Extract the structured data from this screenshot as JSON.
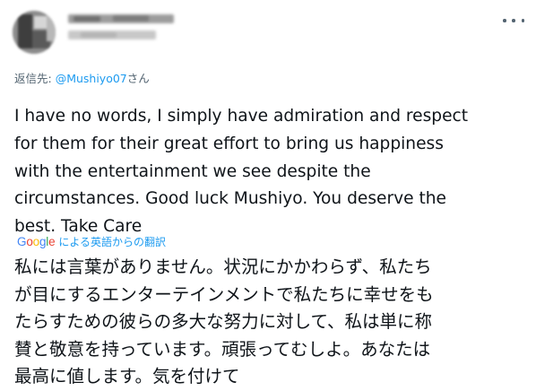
{
  "tweet": {
    "more_icon": "more-horizontal-icon",
    "reply": {
      "prefix": "返信先: ",
      "mention": "@Mushiyo07",
      "suffix": "さん"
    },
    "text": "I have no words, I simply have admiration and respect\nfor them for their great effort to bring us happiness\nwith the entertainment we see despite the\ncircumstances. Good luck Mushiyo. You deserve the\nbest. Take Care",
    "translation": {
      "provider_logo": "Google",
      "label": "による英語からの翻訳",
      "text": "私には言葉がありません。状況にかかわらず、私たち\nが目にするエンターテインメントで私たちに幸せをも\nたらすための彼らの多大な努力に対して、私は単に称\n賛と敬意を持っています。頑張ってむしよ。あなたは\n最高に値します。気を付けて"
    },
    "colors": {
      "text": "#0f1419",
      "secondary": "#536471",
      "link": "#1d9bf0"
    }
  }
}
